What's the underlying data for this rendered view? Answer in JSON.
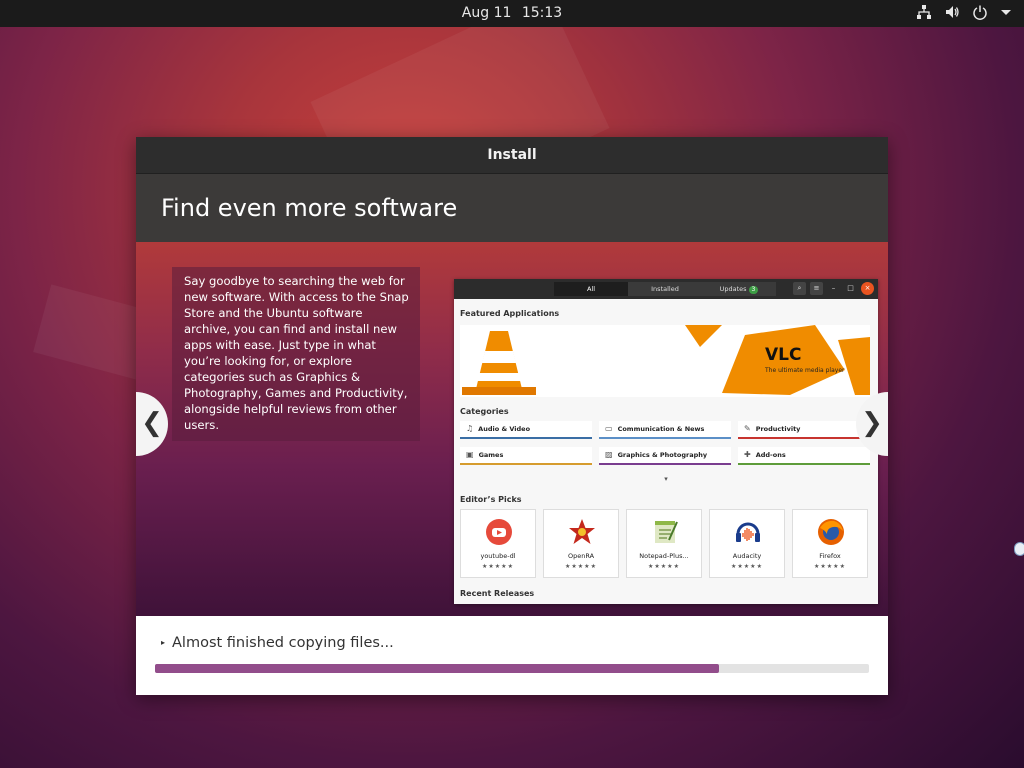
{
  "topbar": {
    "date": "Aug 11",
    "time": "15:13",
    "icons": [
      "network-icon",
      "volume-icon",
      "power-icon",
      "dropdown-arrow-icon"
    ]
  },
  "window": {
    "title": "Install",
    "slide": {
      "heading": "Find even more software",
      "description": "Say goodbye to searching the web for new software. With access to the Snap Store and the Ubuntu software archive, you can find and install new apps with ease. Just type in what you’re looking for, or explore categories such as Graphics & Photography, Games and Productivity, alongside helpful reviews from other users.",
      "prev_glyph": "❮",
      "next_glyph": "❯"
    },
    "software_center": {
      "tabs": [
        "All",
        "Installed",
        "Updates"
      ],
      "updates_badge": "3",
      "featured_label": "Featured Applications",
      "banner_title": "VLC",
      "banner_subtitle": "The ultimate media player",
      "categories_label": "Categories",
      "categories": [
        {
          "label": "Audio & Video",
          "icon": "music-note-icon",
          "color": "#3a6ea5"
        },
        {
          "label": "Communication & News",
          "icon": "chat-icon",
          "color": "#5b8fc7"
        },
        {
          "label": "Productivity",
          "icon": "pen-icon",
          "color": "#c7342f"
        },
        {
          "label": "Games",
          "icon": "gamepad-icon",
          "color": "#d69c2e"
        },
        {
          "label": "Graphics & Photography",
          "icon": "image-icon",
          "color": "#7a3d8f"
        },
        {
          "label": "Add-ons",
          "icon": "puzzle-icon",
          "color": "#5e9c3a"
        }
      ],
      "more_arrow": "▾",
      "picks_label": "Editor’s Picks",
      "picks": [
        {
          "name": "youtube-dl",
          "stars": "★★★★★",
          "icon": "youtube-dl-icon"
        },
        {
          "name": "OpenRA",
          "stars": "★★★★★",
          "icon": "openra-icon"
        },
        {
          "name": "Notepad-Plus...",
          "stars": "★★★★★",
          "icon": "notepad-plus-icon"
        },
        {
          "name": "Audacity",
          "stars": "★★★★★",
          "icon": "audacity-icon"
        },
        {
          "name": "Firefox",
          "stars": "★★★★★",
          "icon": "firefox-icon"
        }
      ],
      "recent_label": "Recent Releases"
    },
    "progress": {
      "expander_glyph": "▸",
      "status": "Almost finished copying files...",
      "fraction": 0.79
    }
  }
}
